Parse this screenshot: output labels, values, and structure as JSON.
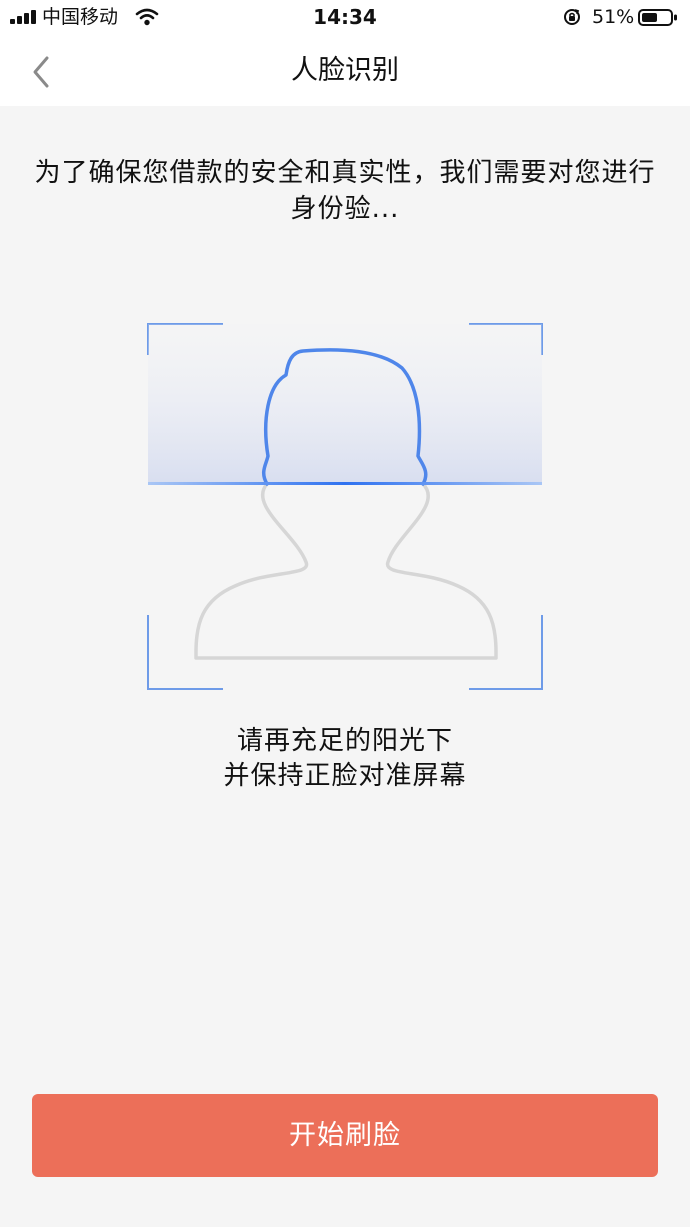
{
  "status_bar": {
    "carrier": "中国移动",
    "time": "14:34",
    "battery_percent": "51%"
  },
  "nav": {
    "title": "人脸识别",
    "back_icon": "chevron-left-icon"
  },
  "intro": {
    "text": "为了确保您借款的安全和真实性，我们需要对您进行身份验..."
  },
  "scan": {
    "frame_color": "#6e9be8",
    "outline_color": "#d3d3d3",
    "scan_color": "#4f86ea"
  },
  "hint": {
    "line1": "请再充足的阳光下",
    "line2": "并保持正脸对准屏幕"
  },
  "actions": {
    "start_label": "开始刷脸",
    "start_color": "#ec6f59"
  }
}
